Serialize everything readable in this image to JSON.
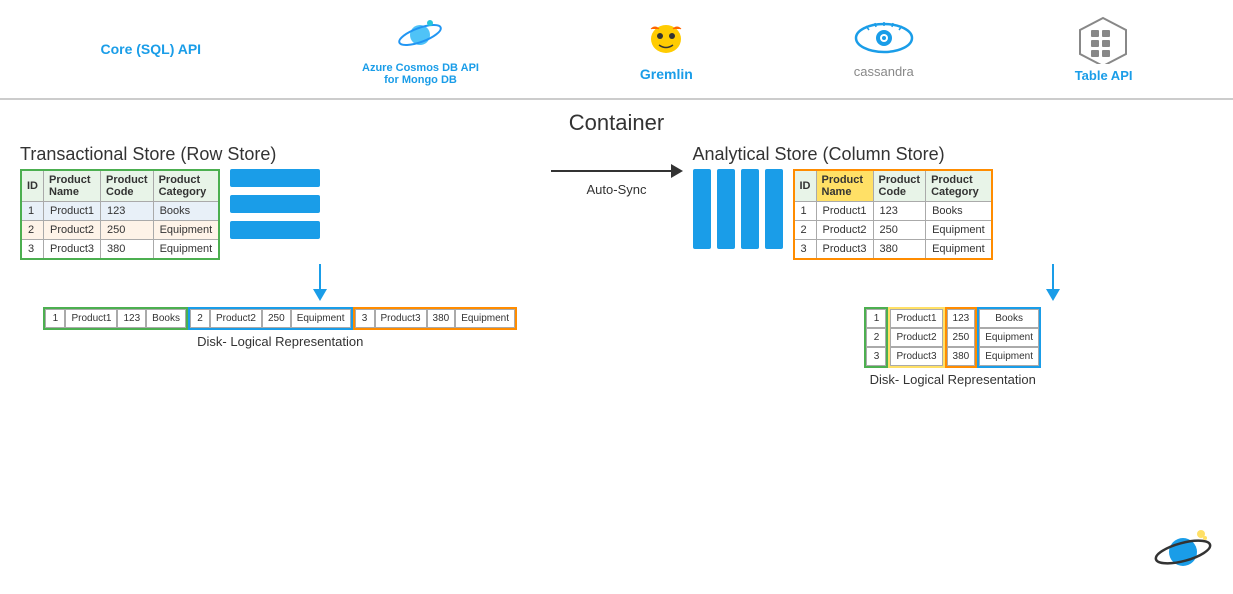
{
  "nav": {
    "items": [
      {
        "id": "core-sql",
        "label": "Core (SQL) API",
        "icon": "🔵"
      },
      {
        "id": "cosmos-mongo",
        "label": "Azure Cosmos DB API\nfor Mongo DB",
        "icon": "🪐"
      },
      {
        "id": "gremlin",
        "label": "Gremlin",
        "icon": "🐲"
      },
      {
        "id": "cassandra",
        "label": "cassandra",
        "icon": "👁"
      },
      {
        "id": "table",
        "label": "Table API",
        "icon": "⊞"
      }
    ]
  },
  "main": {
    "container_title": "Container",
    "transactional_title": "Transactional Store (Row Store)",
    "analytical_title": "Analytical Store (Column Store)",
    "auto_sync_label": "Auto-Sync",
    "disk_label": "Disk- Logical Representation",
    "table": {
      "headers": [
        "ID",
        "Product\nName",
        "Product\nCode",
        "Product\nCategory"
      ],
      "rows": [
        [
          "1",
          "Product1",
          "123",
          "Books"
        ],
        [
          "2",
          "Product2",
          "250",
          "Equipment"
        ],
        [
          "3",
          "Product3",
          "380",
          "Equipment"
        ]
      ]
    },
    "disk_row_store": [
      {
        "group": "green",
        "cells": [
          "1",
          "Product1",
          "123",
          "Books"
        ]
      },
      {
        "group": "blue",
        "cells": [
          "2",
          "Product2",
          "250",
          "Equipment"
        ]
      },
      {
        "group": "orange",
        "cells": [
          "3",
          "Product3",
          "380",
          "Equipment"
        ]
      }
    ],
    "disk_col_store": [
      {
        "group": "green",
        "cells": [
          "1",
          "2",
          "3"
        ]
      },
      {
        "group": "yellow",
        "cells": [
          "Product1",
          "Product2",
          "Product3"
        ]
      },
      {
        "group": "orange",
        "cells": [
          "123",
          "250",
          "380"
        ]
      },
      {
        "group": "blue2",
        "cells": [
          "Books",
          "Equipment",
          "Equipment"
        ]
      }
    ]
  }
}
